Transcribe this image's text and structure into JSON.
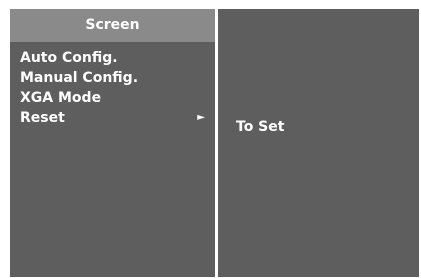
{
  "menu": {
    "title": "Screen",
    "items": [
      {
        "label": "Auto Config."
      },
      {
        "label": "Manual Config."
      },
      {
        "label": "XGA Mode"
      },
      {
        "label": "Reset",
        "submenu_indicator": "►"
      }
    ]
  },
  "submenu": {
    "option": "To Set"
  }
}
